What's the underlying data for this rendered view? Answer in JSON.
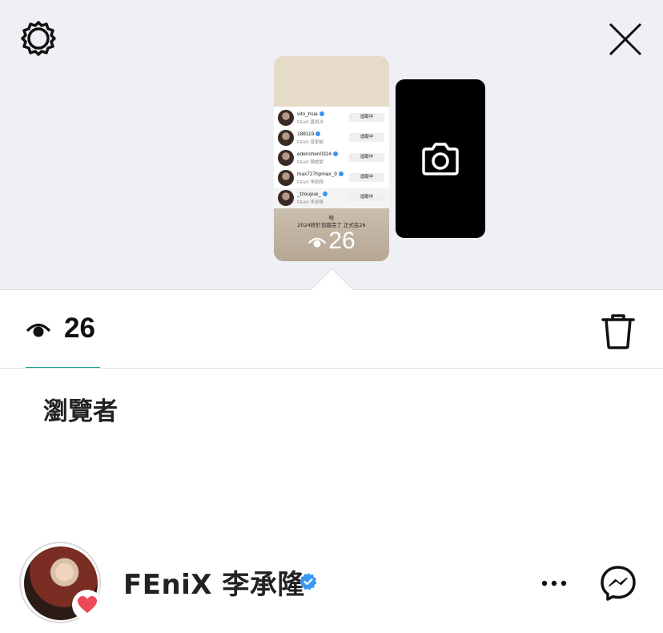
{
  "story": {
    "view_count": "26",
    "preview": {
      "rows": [
        {
          "username": "vito_hsia",
          "subtitle": "FEniX 夏凱洋",
          "action": "追蹤中"
        },
        {
          "username": "188119",
          "subtitle": "FEniX 曾家誠",
          "action": "追蹤中"
        },
        {
          "username": "edenchen0324",
          "subtitle": "FEniX 陳威諺",
          "action": "追蹤中"
        },
        {
          "username": "max727hpmax_9",
          "subtitle": "FEniX 李凱翔",
          "action": "追蹤中"
        },
        {
          "username": "_tzouyue_",
          "subtitle": "FEniX 李承隆",
          "action": "追蹤中"
        }
      ],
      "caption_line1": "哈",
      "caption_line2": "2024終於追蹤完了 正式在26",
      "views": "26"
    }
  },
  "viewers_heading": "瀏覽者",
  "viewers": [
    {
      "name": "FEniX 李承隆",
      "verified": true,
      "reaction": "heart"
    }
  ],
  "icons": {
    "settings": "gear-icon",
    "close": "close-icon",
    "camera": "camera-icon",
    "eye": "eye-icon",
    "trash": "trash-icon",
    "more": "more-horizontal-icon",
    "messenger": "messenger-icon",
    "verified": "verified-badge-icon",
    "heart": "heart-icon"
  },
  "colors": {
    "tab_accent": "#14a08e",
    "verified_blue": "#3897f0",
    "heart_red": "#ed4956"
  }
}
